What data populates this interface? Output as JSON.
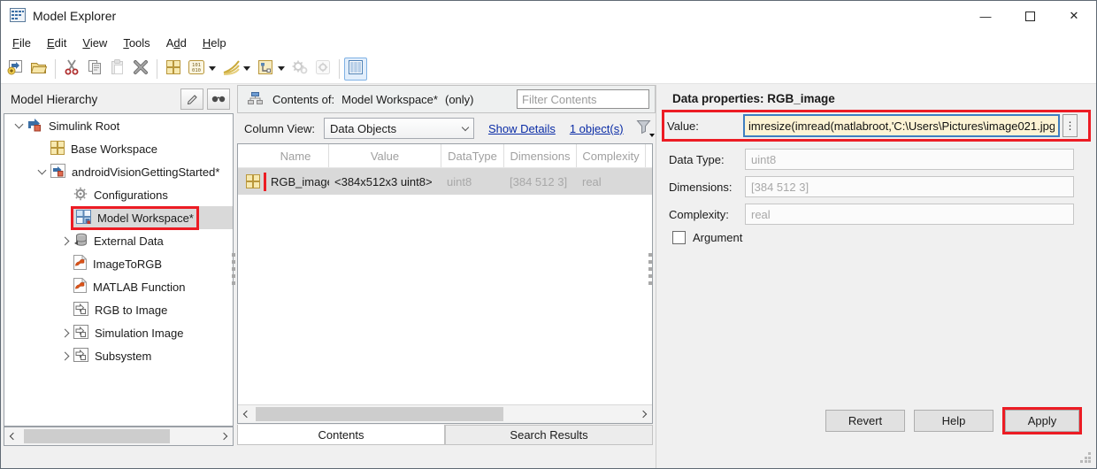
{
  "window": {
    "title": "Model Explorer",
    "minimize_glyph": "—",
    "close_glyph": "✕"
  },
  "menu": {
    "items": [
      {
        "pre": "",
        "key": "F",
        "post": "ile"
      },
      {
        "pre": "",
        "key": "E",
        "post": "dit"
      },
      {
        "pre": "",
        "key": "V",
        "post": "iew"
      },
      {
        "pre": "",
        "key": "T",
        "post": "ools"
      },
      {
        "pre": "A",
        "key": "d",
        "post": "d"
      },
      {
        "pre": "",
        "key": "H",
        "post": "elp"
      }
    ]
  },
  "toolbar": {
    "icons": [
      "new-model",
      "open-folder",
      "cut",
      "copy",
      "paste",
      "delete",
      "base-workspace",
      "code-variables",
      "signal-curves",
      "hierarchy-tree",
      "gears",
      "gear-badge",
      "column-view"
    ]
  },
  "hierarchy": {
    "title": "Model Hierarchy",
    "items": [
      {
        "label": "Simulink Root"
      },
      {
        "label": "Base Workspace"
      },
      {
        "label": "androidVisionGettingStarted*"
      },
      {
        "label": "Configurations"
      },
      {
        "label": "Model Workspace*"
      },
      {
        "label": "External Data"
      },
      {
        "label": "ImageToRGB"
      },
      {
        "label": "MATLAB Function"
      },
      {
        "label": "RGB to Image"
      },
      {
        "label": "Simulation Image"
      },
      {
        "label": "Subsystem"
      }
    ]
  },
  "contents": {
    "header_label": "Contents of:",
    "header_target": "Model Workspace*",
    "header_suffix": "(only)",
    "filter_placeholder": "Filter Contents",
    "column_view_label": "Column View:",
    "column_view_value": "Data Objects",
    "show_details_link": "Show Details",
    "objects_link": "1 object(s)",
    "table": {
      "columns": [
        "Name",
        "Value",
        "DataType",
        "Dimensions",
        "Complexity",
        "M"
      ],
      "row": {
        "name": "RGB_image",
        "value": "<384x512x3 uint8>",
        "datatype": "uint8",
        "dimensions": "[384 512 3]",
        "complexity": "real"
      }
    },
    "tabs": [
      {
        "label": "Contents"
      },
      {
        "label": "Search Results"
      }
    ]
  },
  "properties": {
    "title": "Data properties: RGB_image",
    "value_label": "Value:",
    "value": "imresize(imread(matlabroot,'C:\\Users\\Pictures\\image021.jpg'",
    "value_menu_glyph": "⋮",
    "datatype_label": "Data Type:",
    "datatype": "uint8",
    "dimensions_label": "Dimensions:",
    "dimensions": "[384 512 3]",
    "complexity_label": "Complexity:",
    "complexity": "real",
    "argument_label": "Argument",
    "buttons": {
      "revert": "Revert",
      "help": "Help",
      "apply": "Apply"
    }
  },
  "colors": {
    "annotation_red": "#ec1c24",
    "value_field_bg": "#fcf3d4",
    "value_field_border": "#3f7fc1",
    "link_blue": "#0a2ca6",
    "selection_gray": "#d9d9d9"
  }
}
